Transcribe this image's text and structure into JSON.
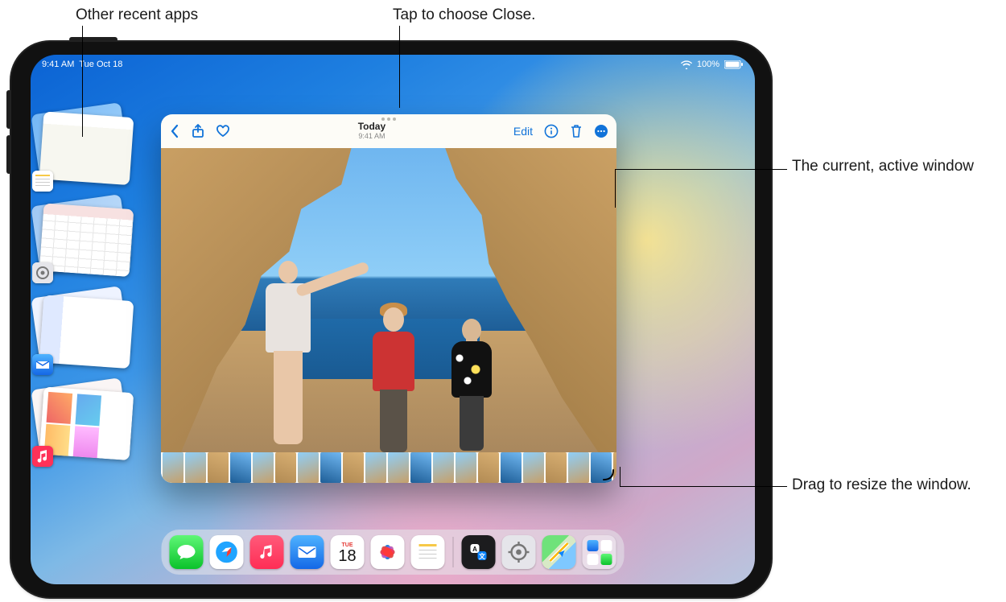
{
  "status_bar": {
    "time": "9:41 AM",
    "date": "Tue Oct 18",
    "battery_pct": "100%"
  },
  "callouts": {
    "recent_apps": "Other recent apps",
    "close": "Tap to choose Close.",
    "active_window": "The current, active window",
    "resize": "Drag to resize the window."
  },
  "window": {
    "title": "Today",
    "subtitle": "9:41 AM",
    "buttons": {
      "edit": "Edit"
    }
  },
  "dock": {
    "calendar_day": "18",
    "calendar_dow": "TUE"
  }
}
